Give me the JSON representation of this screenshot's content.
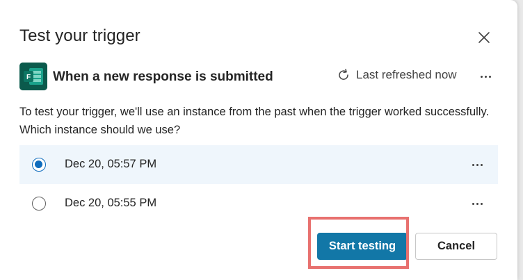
{
  "dialog": {
    "title": "Test your trigger",
    "close_icon": "close-icon"
  },
  "trigger": {
    "app_icon": "microsoft-forms-icon",
    "name": "When a new response is submitted",
    "refresh_icon": "refresh-icon",
    "refresh_label": "Last refreshed now",
    "more_icon": "more-horizontal-icon"
  },
  "description": "To test your trigger, we'll use an instance from the past when the trigger worked successfully. Which instance should we use?",
  "instances": [
    {
      "label": "Dec 20, 05:57 PM",
      "selected": true
    },
    {
      "label": "Dec 20, 05:55 PM",
      "selected": false
    }
  ],
  "buttons": {
    "primary_label": "Start testing",
    "secondary_label": "Cancel"
  },
  "colors": {
    "primary_button": "#1277a7",
    "selected_row": "#eff6fc",
    "radio_checked": "#0f6cbd",
    "highlight_border": "#e8716f",
    "forms_icon_bg": "#0b5a4c"
  }
}
